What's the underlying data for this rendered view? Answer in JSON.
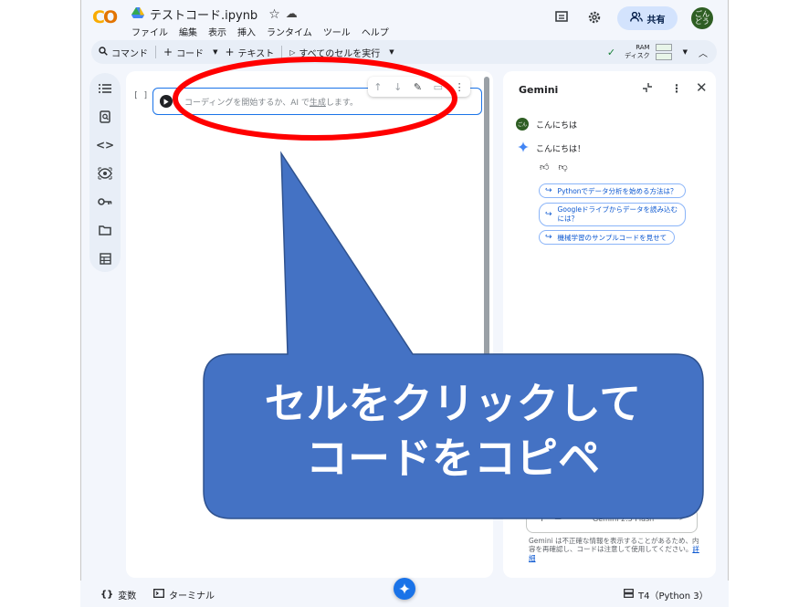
{
  "app": {
    "logo": "CO",
    "file_title": "テストコード.ipynb",
    "menus": [
      "ファイル",
      "編集",
      "表示",
      "挿入",
      "ランタイム",
      "ツール",
      "ヘルプ"
    ],
    "share_label": "共有",
    "avatar_text": "ごん\nどう"
  },
  "toolbar": {
    "command": "コマンド",
    "add_code": "コード",
    "add_text": "テキスト",
    "run_all": "すべてのセルを実行",
    "ram_label": "RAM",
    "disk_label": "ディスク"
  },
  "cell": {
    "bracket": "[ ]",
    "placeholder_before": "コーディングを開始するか、AI で",
    "placeholder_link": "生成",
    "placeholder_after": "します。"
  },
  "gemini": {
    "title": "Gemini",
    "user_message": "こんにちは",
    "reply": "こんにちは！",
    "suggestions": [
      "Pythonでデータ分析を始める方法は？",
      "Googleドライブからデータを読み込む\nには？",
      "機械学習のサンプルコードを見せて"
    ],
    "model": "Gemini 2.5 Flash",
    "disclaimer": "Gemini は不正確な情報を表示することがあるため、内容を再確認し、コードは注意して使用してください。",
    "disclaimer_link": "詳細"
  },
  "statusbar": {
    "variables": "変数",
    "terminal": "ターミナル",
    "runtime": "T4（Python 3）"
  },
  "annotation": {
    "line1": "セルをクリックして",
    "line2": "コードをコピペ",
    "callout_color": "#4472c4",
    "ellipse_color": "#ff0000"
  }
}
